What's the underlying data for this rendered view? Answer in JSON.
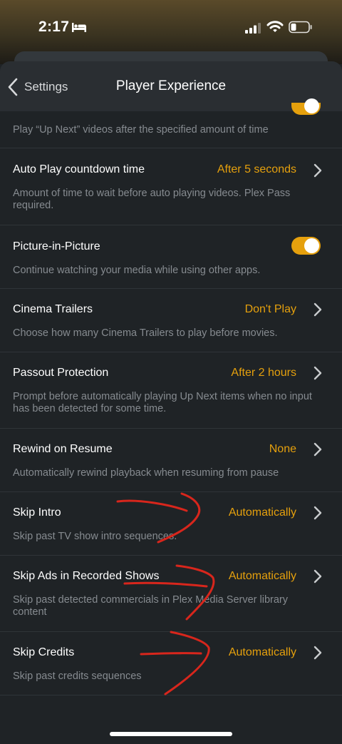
{
  "status_bar": {
    "time": "2:17"
  },
  "nav": {
    "back_label": "Settings",
    "title": "Player Experience"
  },
  "rows": [
    {
      "description": "Play “Up Next” videos after the specified amount of time",
      "toggle": true
    },
    {
      "title": "Auto Play countdown time",
      "value": "After 5 seconds",
      "description": "Amount of time to wait before auto playing videos. Plex Pass required."
    },
    {
      "title": "Picture-in-Picture",
      "description": "Continue watching your media while using other apps.",
      "toggle": true
    },
    {
      "title": "Cinema Trailers",
      "value": "Don't Play",
      "description": "Choose how many Cinema Trailers to play before movies."
    },
    {
      "title": "Passout Protection",
      "value": "After 2 hours",
      "description": "Prompt before automatically playing Up Next items when no input has been detected for some time."
    },
    {
      "title": "Rewind on Resume",
      "value": "None",
      "description": "Automatically rewind playback when resuming from pause"
    },
    {
      "title": "Skip Intro",
      "value": "Automatically",
      "description": "Skip past TV show intro sequences."
    },
    {
      "title": "Skip Ads in Recorded Shows",
      "value": "Automatically",
      "description": "Skip past detected commercials in Plex Media Server library content"
    },
    {
      "title": "Skip Credits",
      "value": "Automatically",
      "description": "Skip past credits sequences"
    }
  ],
  "colors": {
    "accent": "#e5a00d",
    "background": "#1f2326",
    "annotation": "#d8261c"
  }
}
